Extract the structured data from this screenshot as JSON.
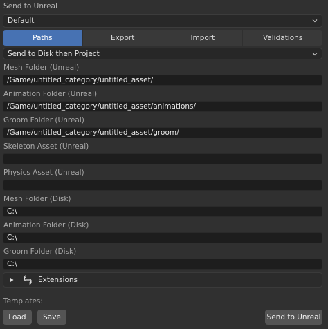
{
  "header": {
    "title": "Send to Unreal"
  },
  "template_select": {
    "value": "Default"
  },
  "tabs": [
    {
      "label": "Paths",
      "active": true
    },
    {
      "label": "Export",
      "active": false
    },
    {
      "label": "Import",
      "active": false
    },
    {
      "label": "Validations",
      "active": false
    }
  ],
  "send_mode": {
    "value": "Send to Disk then Project"
  },
  "fields": {
    "mesh_folder_unreal": {
      "label": "Mesh Folder (Unreal)",
      "value": "/Game/untitled_category/untitled_asset/"
    },
    "animation_folder_unreal": {
      "label": "Animation Folder (Unreal)",
      "value": "/Game/untitled_category/untitled_asset/animations/"
    },
    "groom_folder_unreal": {
      "label": "Groom Folder (Unreal)",
      "value": "/Game/untitled_category/untitled_asset/groom/"
    },
    "skeleton_asset_unreal": {
      "label": "Skeleton Asset (Unreal)",
      "value": ""
    },
    "physics_asset_unreal": {
      "label": "Physics Asset (Unreal)",
      "value": ""
    },
    "mesh_folder_disk": {
      "label": "Mesh Folder (Disk)",
      "value": "C:\\"
    },
    "animation_folder_disk": {
      "label": "Animation Folder (Disk)",
      "value": "C:\\"
    },
    "groom_folder_disk": {
      "label": "Groom Folder (Disk)",
      "value": "C:\\"
    }
  },
  "extensions": {
    "label": "Extensions",
    "icon": "extensions-icon",
    "expanded": false
  },
  "templates": {
    "label": "Templates:"
  },
  "buttons": {
    "load": "Load",
    "save": "Save",
    "send": "Send to Unreal"
  },
  "colors": {
    "active_tab": "#4772b3",
    "background": "#303030",
    "field": "#1d1d1d"
  }
}
